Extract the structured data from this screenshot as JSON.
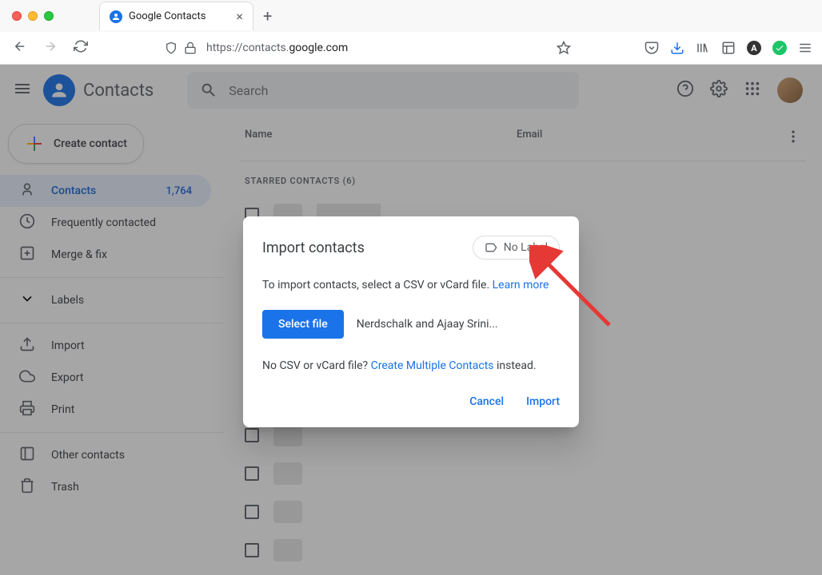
{
  "browser": {
    "tab_title": "Google Contacts",
    "url_prefix": "https://contacts.",
    "url_domain": "google.com"
  },
  "header": {
    "app_name": "Contacts",
    "search_placeholder": "Search"
  },
  "sidebar": {
    "create_label": "Create contact",
    "items": [
      {
        "label": "Contacts",
        "count": "1,764"
      },
      {
        "label": "Frequently contacted"
      },
      {
        "label": "Merge & fix"
      }
    ],
    "labels_section": "Labels",
    "actions": [
      {
        "label": "Import"
      },
      {
        "label": "Export"
      },
      {
        "label": "Print"
      }
    ],
    "other_contacts": "Other contacts",
    "trash": "Trash"
  },
  "table": {
    "col_name": "Name",
    "col_email": "Email",
    "starred_header": "STARRED CONTACTS (6)"
  },
  "modal": {
    "title": "Import contacts",
    "label_chip": "No Label",
    "intro": "To import contacts, select a CSV or vCard file. ",
    "learn_more": "Learn more",
    "select_file": "Select file",
    "selected_filename": "Nerdschalk and Ajaay Srini...",
    "nocsv_prefix": "No CSV or vCard file? ",
    "create_multiple": "Create Multiple Contacts",
    "nocsv_suffix": " instead.",
    "cancel": "Cancel",
    "import": "Import"
  }
}
